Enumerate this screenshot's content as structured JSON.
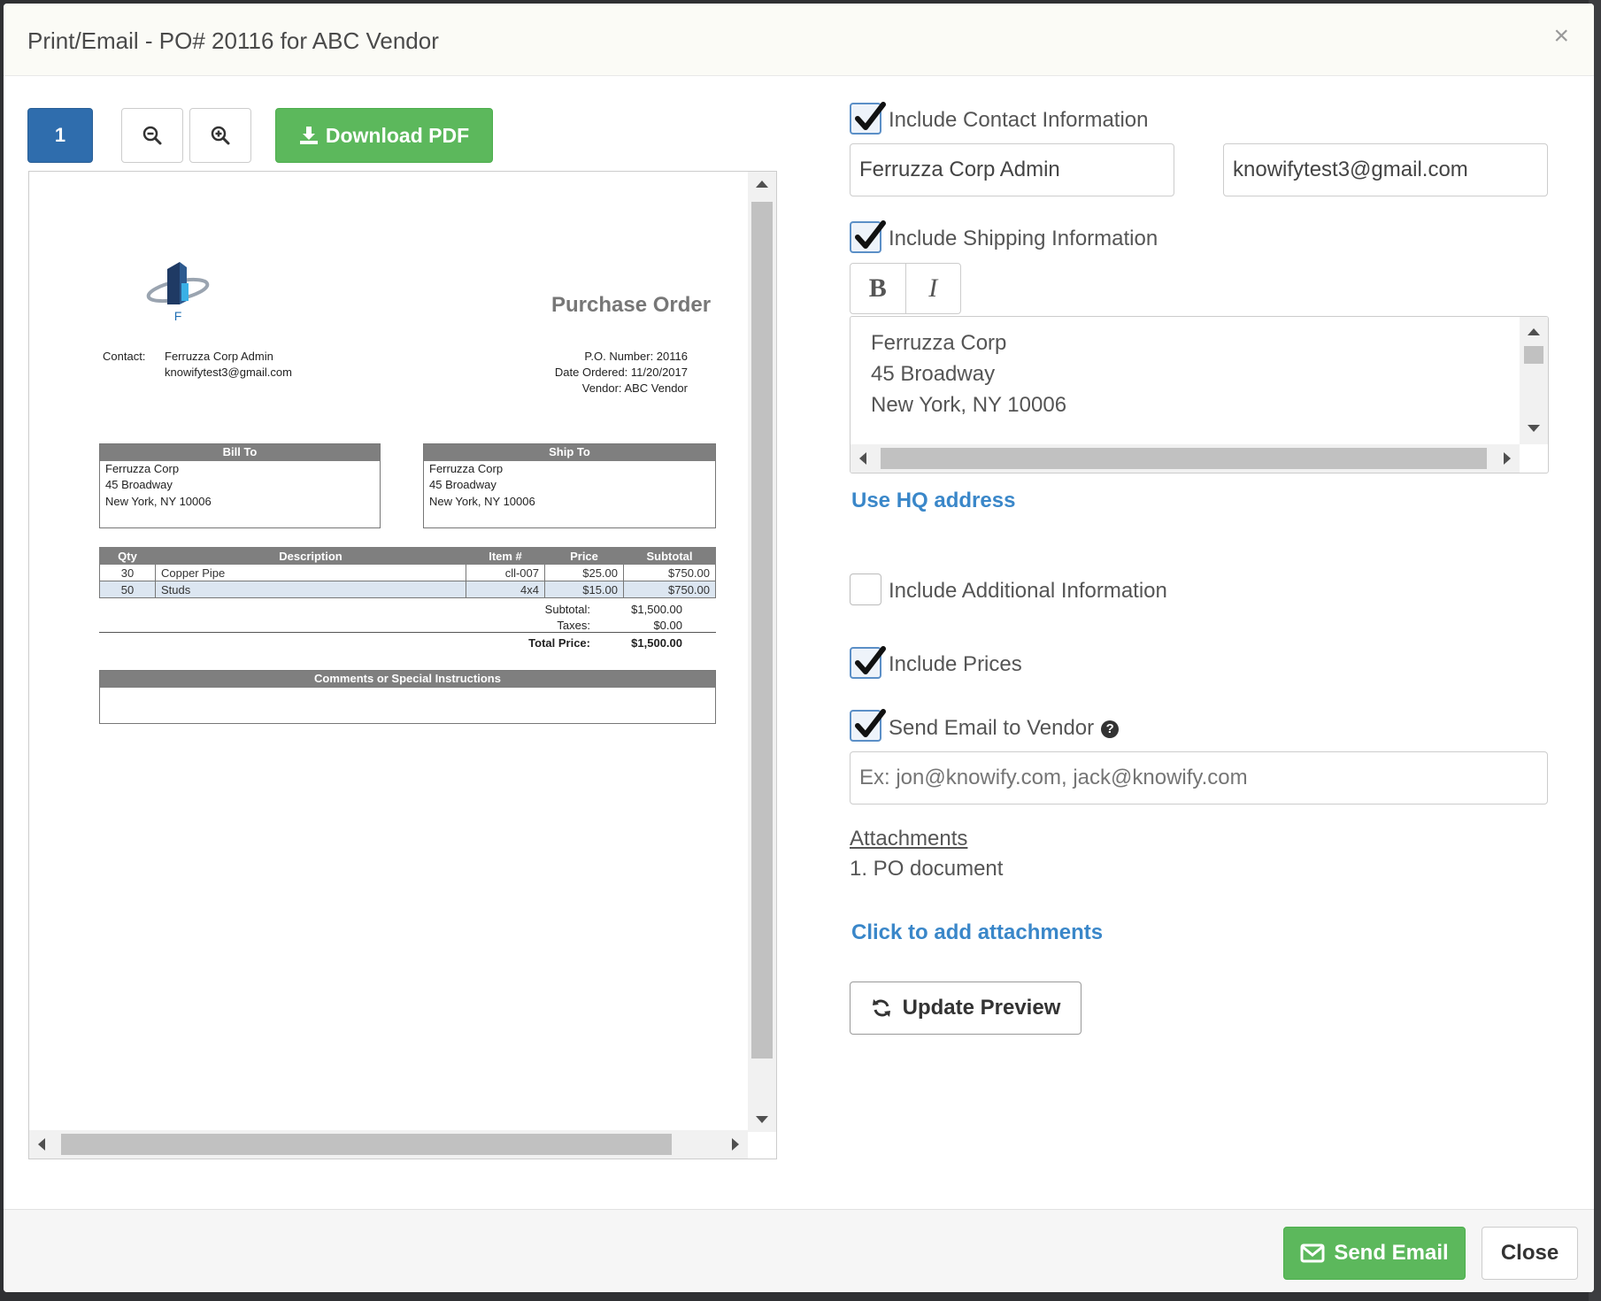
{
  "modal": {
    "title": "Print/Email - PO# 20116 for ABC Vendor",
    "close_glyph": "×"
  },
  "preview_toolbar": {
    "page_number": "1",
    "zoom_out_icon": "zoom-out-icon",
    "zoom_in_icon": "zoom-in-icon",
    "download_label": "Download PDF",
    "download_icon": "download-icon"
  },
  "document": {
    "logo_letter": "F",
    "title": "Purchase Order",
    "contact_label": "Contact:",
    "contact_name": "Ferruzza Corp Admin",
    "contact_email": "knowifytest3@gmail.com",
    "po_number": "P.O. Number: 20116",
    "date_ordered": "Date Ordered: 11/20/2017",
    "vendor": "Vendor: ABC Vendor",
    "bill_to": {
      "heading": "Bill To",
      "line1": "Ferruzza Corp",
      "line2": "45 Broadway",
      "line3": "New York, NY 10006"
    },
    "ship_to": {
      "heading": "Ship To",
      "line1": "Ferruzza Corp",
      "line2": "45 Broadway",
      "line3": "New York, NY 10006"
    },
    "items": {
      "headers": [
        "Qty",
        "Description",
        "Item #",
        "Price",
        "Subtotal"
      ],
      "rows": [
        [
          "30",
          "Copper Pipe",
          "cll-007",
          "$25.00",
          "$750.00"
        ],
        [
          "50",
          "Studs",
          "4x4",
          "$15.00",
          "$750.00"
        ]
      ]
    },
    "totals": {
      "subtotal_label": "Subtotal:",
      "subtotal_value": "$1,500.00",
      "taxes_label": "Taxes:",
      "taxes_value": "$0.00",
      "total_label": "Total Price:",
      "total_value": "$1,500.00"
    },
    "comments_heading": "Comments or Special Instructions"
  },
  "options": {
    "contact": {
      "label": "Include Contact Information",
      "checked": true,
      "name_value": "Ferruzza Corp Admin",
      "email_value": "knowifytest3@gmail.com"
    },
    "shipping": {
      "label": "Include Shipping Information",
      "checked": true,
      "bold_label": "B",
      "italic_label": "I",
      "address_line1": "Ferruzza Corp",
      "address_line2": "45 Broadway",
      "address_line3": "New York, NY 10006",
      "hq_link": "Use HQ address"
    },
    "additional": {
      "label": "Include Additional Information",
      "checked": false
    },
    "prices": {
      "label": "Include Prices",
      "checked": true
    },
    "send_to_vendor": {
      "label": "Send Email to Vendor",
      "checked": true,
      "help_glyph": "?",
      "recipients_placeholder": "Ex: jon@knowify.com, jack@knowify.com"
    },
    "attachments": {
      "title": "Attachments",
      "items": [
        "1.  PO document"
      ],
      "add_link": "Click to add attachments"
    },
    "update_preview_label": "Update Preview"
  },
  "footer": {
    "send_label": "Send Email",
    "close_label": "Close"
  },
  "colors": {
    "primary": "#2f6dad",
    "success": "#5cb85c",
    "link": "#3a87c9"
  }
}
